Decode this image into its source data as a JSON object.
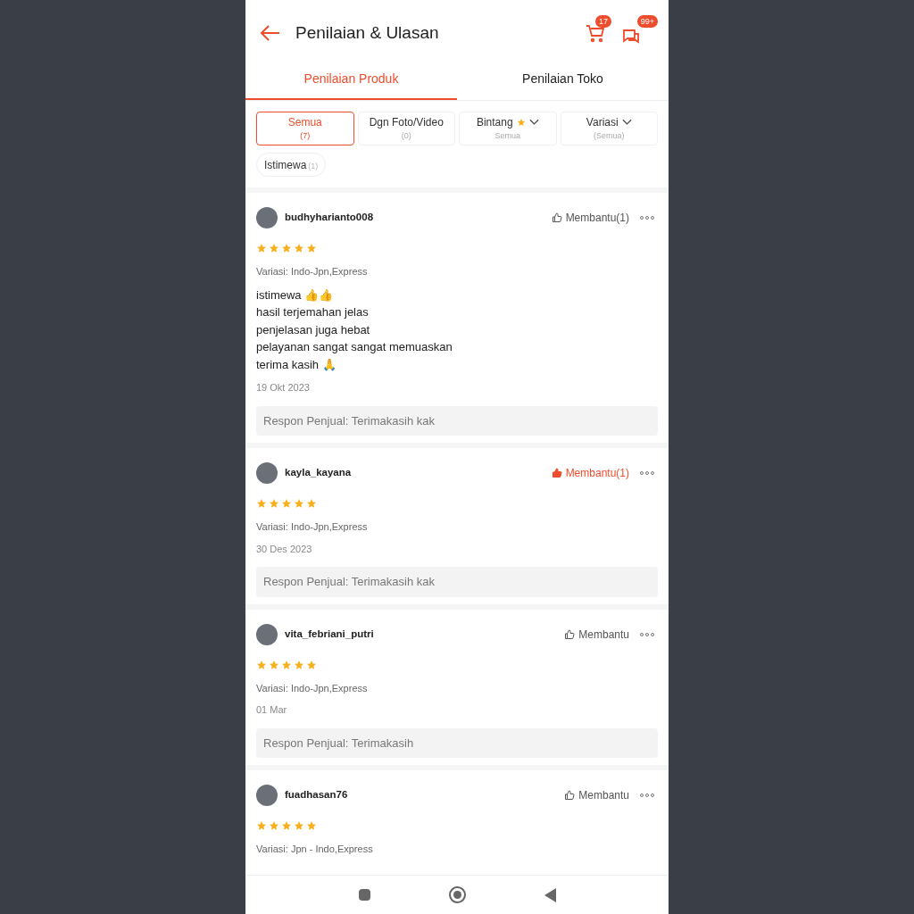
{
  "header": {
    "title": "Penilaian & Ulasan",
    "cart_badge": "17",
    "chat_badge": "99+"
  },
  "tabs": [
    {
      "label": "Penilaian Produk",
      "selected": true
    },
    {
      "label": "Penilaian Toko",
      "selected": false
    }
  ],
  "filters": [
    {
      "label": "Semua",
      "sub": "(7)",
      "selected": true,
      "kind": "plain"
    },
    {
      "label": "Dgn Foto/Video",
      "sub": "(0)",
      "selected": false,
      "kind": "plain"
    },
    {
      "label": "Bintang",
      "sub": "Semua",
      "selected": false,
      "kind": "star-dropdown"
    },
    {
      "label": "Variasi",
      "sub": "(Semua)",
      "selected": false,
      "kind": "dropdown"
    }
  ],
  "tags": [
    {
      "label": "Istimewa",
      "count": "(1)",
      "selected": false
    }
  ],
  "reviews": [
    {
      "user": "budhyharianto008",
      "helpful": "Membantu(1)",
      "liked": false,
      "stars": 5,
      "variation": "Variasi: Indo-Jpn,Express",
      "comment": "istimewa 👍👍\nhasil terjemahan jelas\npenjelasan juga hebat\npelayanan sangat sangat memuaskan\nterima kasih 🙏",
      "date": "19 Okt 2023",
      "response": "Respon Penjual: Terimakasih kak"
    },
    {
      "user": "kayla_kayana",
      "helpful": "Membantu(1)",
      "liked": true,
      "stars": 5,
      "variation": "Variasi: Indo-Jpn,Express",
      "date": "30 Des 2023",
      "response": "Respon Penjual: Terimakasih kak"
    },
    {
      "user": "vita_febriani_putri",
      "helpful": "Membantu",
      "liked": false,
      "stars": 5,
      "variation": "Variasi: Indo-Jpn,Express",
      "date": "01 Mar",
      "response": "Respon Penjual: Terimakasih"
    },
    {
      "user": "fuadhasan76",
      "helpful": "Membantu",
      "liked": false,
      "stars": 5,
      "variation": "Variasi: Jpn - Indo,Express"
    }
  ]
}
